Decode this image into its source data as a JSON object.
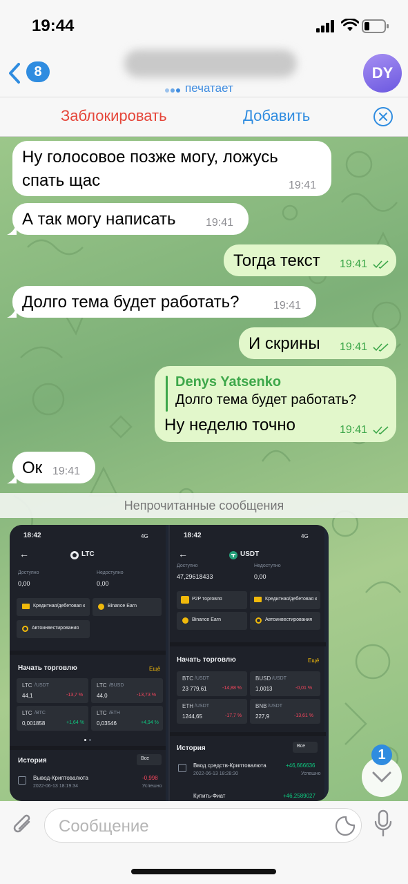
{
  "status": {
    "time": "19:44"
  },
  "header": {
    "back_count": "8",
    "typing": "печатает",
    "avatar_initials": "DY"
  },
  "actions": {
    "block": "Заблокировать",
    "add": "Добавить"
  },
  "messages": [
    {
      "dir": "in",
      "text_lines": [
        "Ну голосовое позже могу, ложусь",
        "спать щас"
      ],
      "time": "19:41"
    },
    {
      "dir": "in",
      "text": "А так могу написать",
      "time": "19:41"
    },
    {
      "dir": "out",
      "text": "Тогда текст",
      "time": "19:41"
    },
    {
      "dir": "in",
      "text": "Долго тема будет работать?",
      "time": "19:41"
    },
    {
      "dir": "out",
      "text": "И скрины",
      "time": "19:41"
    },
    {
      "dir": "out",
      "reply_name": "Denys Yatsenko",
      "reply_text": "Долго тема будет работать?",
      "text": "Ну неделю точно",
      "time": "19:41"
    },
    {
      "dir": "in",
      "text": "Ок",
      "time": "19:41"
    }
  ],
  "unread_label": "Непрочитанные сообщения",
  "screenshot": {
    "left": {
      "time": "18:42",
      "network": "4G",
      "coin": "LTC",
      "available_label": "Доступно",
      "unavailable_label": "Недоступно",
      "available": "0,00",
      "unavailable": "0,00",
      "menu": [
        "Кредитная/дебетовая к",
        "Binance Earn",
        "Автоинвестирования"
      ],
      "trade_title": "Начать торговлю",
      "more": "Ещё",
      "pairs": [
        {
          "base": "LTC",
          "quote": "/USDT",
          "price": "44,1",
          "change": "-13,7 %"
        },
        {
          "base": "LTC",
          "quote": "/BUSD",
          "price": "44,0",
          "change": "-13,73 %"
        },
        {
          "base": "LTC",
          "quote": "/BTC",
          "price": "0,001858",
          "change": "+1,64 %"
        },
        {
          "base": "LTC",
          "quote": "/ETH",
          "price": "0,03546",
          "change": "+4,94 %"
        }
      ],
      "history_title": "История",
      "filter": "Все",
      "history": [
        {
          "title": "Вывод-Криптовалюта",
          "date": "2022-06-13 18:19:34",
          "amount": "-0,998",
          "status": "Успешно"
        }
      ]
    },
    "right": {
      "time": "18:42",
      "network": "4G",
      "coin": "USDT",
      "available_label": "Доступно",
      "unavailable_label": "Недоступно",
      "available": "47,29618433",
      "unavailable": "0,00",
      "menu": [
        "P2P торговля",
        "Кредитная/дебетовая к",
        "Binance Earn",
        "Автоинвестирования"
      ],
      "trade_title": "Начать торговлю",
      "more": "Ещё",
      "pairs": [
        {
          "base": "BTC",
          "quote": "/USDT",
          "price": "23 779,61",
          "change": "-14,88 %"
        },
        {
          "base": "BUSD",
          "quote": "/USDT",
          "price": "1,0013",
          "change": "-0,01 %"
        },
        {
          "base": "ETH",
          "quote": "/USDT",
          "price": "1244,65",
          "change": "-17,7 %"
        },
        {
          "base": "BNB",
          "quote": "/USDT",
          "price": "227,9",
          "change": "-13,61 %"
        }
      ],
      "history_title": "История",
      "filter": "Все",
      "history": [
        {
          "title": "Ввод средств-Криптовалюта",
          "date": "2022-06-13 18:28:30",
          "amount": "+46,666636",
          "status": "Успешно"
        },
        {
          "title": "Купить-Фиат",
          "amount": "+46,2589027"
        }
      ]
    }
  },
  "scroll_badge": "1",
  "input": {
    "placeholder": "Сообщение"
  },
  "colors": {
    "accent": "#2f8ce0",
    "danger": "#e5463a",
    "outgoing": "#e2f7cb",
    "time_out": "#3da74a"
  }
}
